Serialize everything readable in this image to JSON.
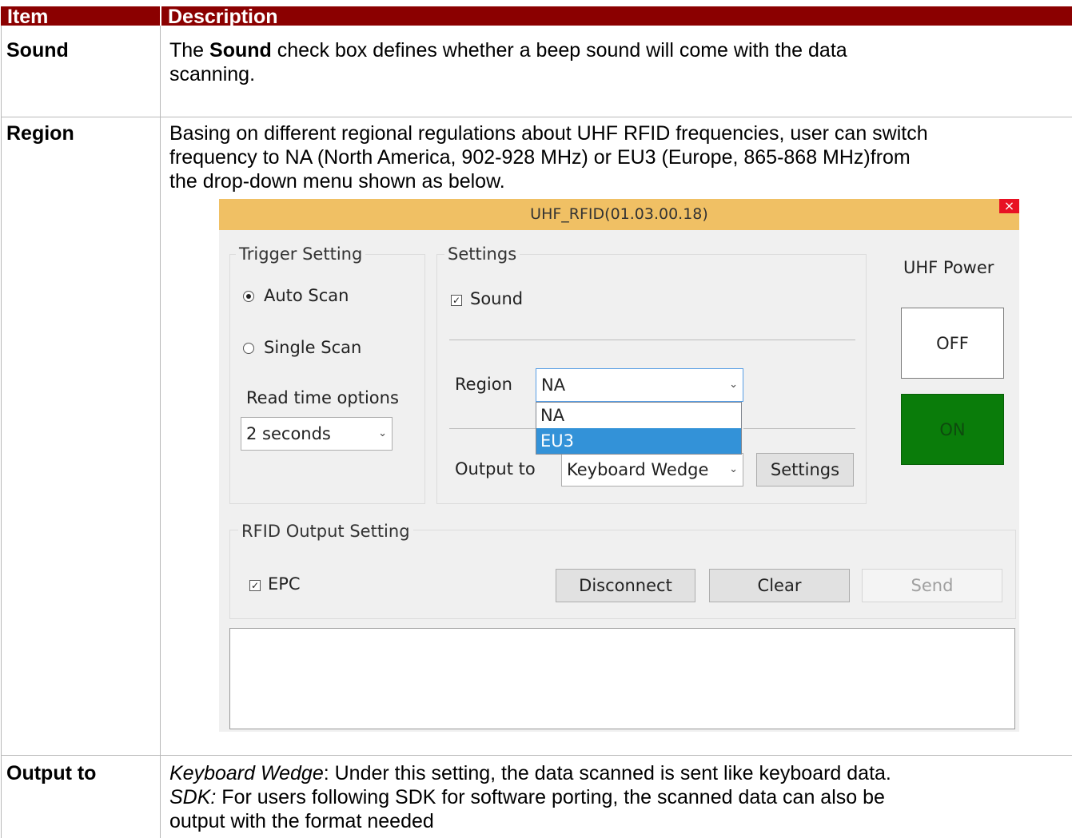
{
  "table": {
    "headers": {
      "item": "Item",
      "description": "Description"
    },
    "rows": [
      {
        "item": "Sound",
        "desc_pre": "The ",
        "desc_bold": "Sound",
        "desc_post": " check box defines whether a beep sound will come with the data",
        "desc_line2": "scanning."
      },
      {
        "item": "Region",
        "line1": "Basing on different regional regulations about UHF RFID frequencies, user can switch",
        "line2": "frequency to NA (North America, 902-928 MHz) or EU3 (Europe, 865-868 MHz)from",
        "line3": "the drop-down menu shown as below."
      },
      {
        "item": "Output to",
        "kw_label": "Keyboard Wedge",
        "kw_text": ": Under this setting, the data scanned is sent like keyboard data.",
        "sdk_label": "SDK:",
        "sdk_text": " For users following SDK for software porting, the scanned data can also be",
        "line3": "output with the format needed"
      }
    ]
  },
  "app": {
    "title": "UHF_RFID(01.03.00.18)",
    "close_glyph": "×",
    "trigger": {
      "legend": "Trigger Setting",
      "auto_scan": "Auto Scan",
      "single_scan": "Single Scan",
      "read_time_label": "Read time options",
      "read_time_value": "2 seconds"
    },
    "settings": {
      "legend": "Settings",
      "sound": "Sound",
      "region_label": "Region",
      "region_value": "NA",
      "region_options": [
        "NA",
        "EU3"
      ],
      "output_label": "Output to",
      "output_value": "Keyboard Wedge",
      "settings_button": "Settings"
    },
    "power": {
      "label": "UHF Power",
      "off": "OFF",
      "on": "ON",
      "on_color": "#0a7c0a"
    },
    "rfid": {
      "legend": "RFID Output Setting",
      "epc": "EPC",
      "disconnect": "Disconnect",
      "clear": "Clear",
      "send": "Send"
    },
    "chevron_glyph": "⌄",
    "check_glyph": "✓"
  }
}
